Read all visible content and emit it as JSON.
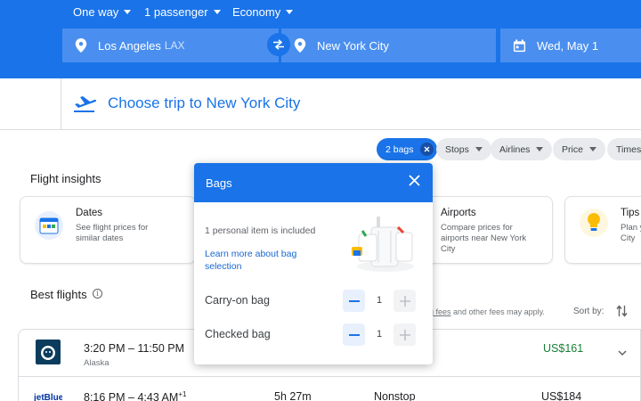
{
  "search": {
    "trip_type": "One way",
    "passengers": "1 passenger",
    "cabin": "Economy",
    "origin": "Los Angeles",
    "origin_code": "LAX",
    "destination": "New York City",
    "date": "Wed, May 1"
  },
  "trip_header": "Choose trip to New York City",
  "filters": {
    "bags": "2 bags",
    "stops": "Stops",
    "airlines": "Airlines",
    "price": "Price",
    "times": "Times"
  },
  "insights": {
    "title": "Flight insights",
    "dates_title": "Dates",
    "dates_desc": "See flight prices for similar dates",
    "airports_title": "Airports",
    "airports_desc": "Compare prices for airports near New York City",
    "tips_title": "Tips",
    "tips_desc": "Plan y City"
  },
  "best_flights": "Best flights",
  "fees_link": "g fees",
  "fees_text": " and other fees may apply.",
  "sort_label": "Sort by:",
  "flights": [
    {
      "times": "3:20 PM – 11:50 PM",
      "airline": "Alaska",
      "price": "US$161"
    },
    {
      "times": "8:16 PM – 4:43 AM",
      "day_offset": "+1",
      "duration": "5h 27m",
      "stops": "Nonstop",
      "price": "US$184"
    }
  ],
  "bags_dialog": {
    "title": "Bags",
    "note": "1 personal item is included",
    "learn_more": "Learn more about bag selection",
    "carry_on_label": "Carry-on bag",
    "carry_on_count": "1",
    "checked_label": "Checked bag",
    "checked_count": "1"
  },
  "colors": {
    "accent": "#1a73e8",
    "price_green": "#188038"
  },
  "icons": [
    "pin-icon",
    "swap-icon",
    "calendar-icon",
    "plane-depart-icon",
    "close-icon",
    "caret-down-icon",
    "info-icon",
    "sort-icon",
    "chevron-down-icon",
    "minus-icon",
    "plus-icon"
  ]
}
